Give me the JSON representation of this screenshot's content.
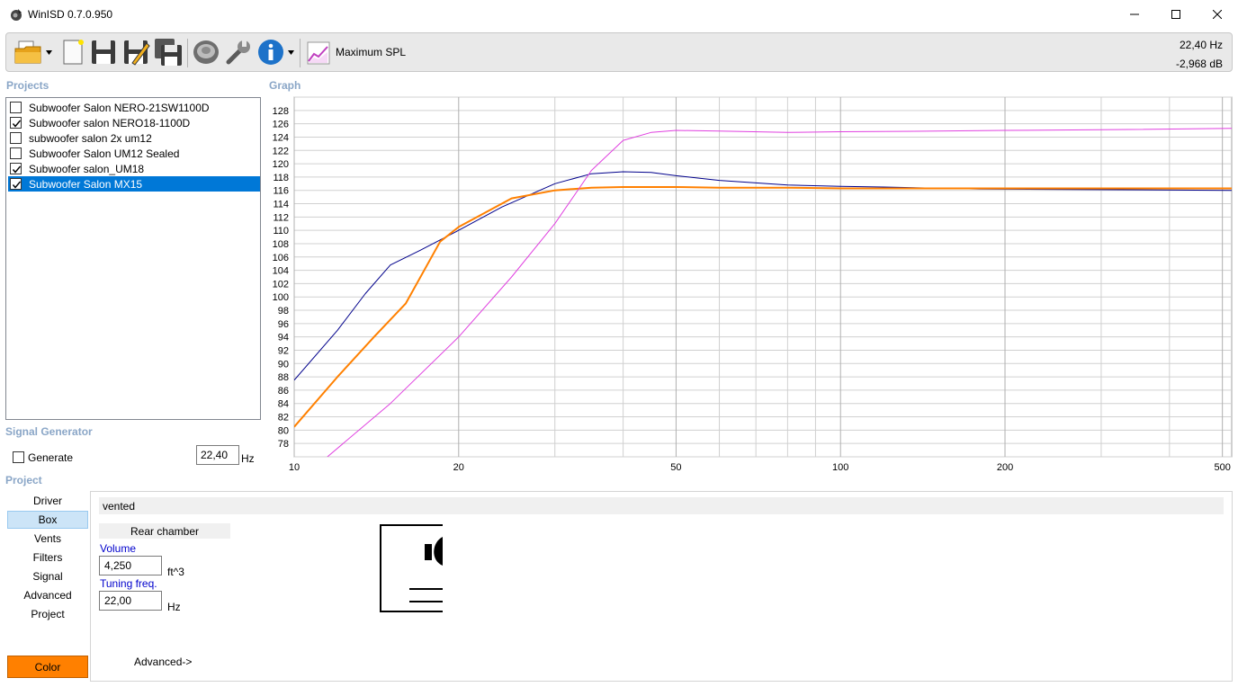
{
  "window": {
    "title": "WinISD 0.7.0.950"
  },
  "toolbar": {
    "mode_label": "Maximum SPL",
    "readout_freq": "22,40 Hz",
    "readout_db": "-2,968 dB"
  },
  "sections": {
    "projects": "Projects",
    "graph": "Graph",
    "signal_generator": "Signal Generator",
    "project": "Project"
  },
  "projects": [
    {
      "label": "Subwoofer Salon NERO-21SW1100D",
      "checked": false,
      "selected": false
    },
    {
      "label": "Subwoofer salon NERO18-1100D",
      "checked": true,
      "selected": false
    },
    {
      "label": "subwoofer salon 2x um12",
      "checked": false,
      "selected": false
    },
    {
      "label": "Subwoofer Salon UM12 Sealed",
      "checked": false,
      "selected": false
    },
    {
      "label": "Subwoofer salon_UM18",
      "checked": true,
      "selected": false
    },
    {
      "label": "Subwoofer Salon MX15",
      "checked": true,
      "selected": true
    }
  ],
  "signal_generator": {
    "generate_label": "Generate",
    "generate_checked": false,
    "frequency": "22,40",
    "unit": "Hz"
  },
  "nav": {
    "items": [
      "Driver",
      "Box",
      "Vents",
      "Filters",
      "Signal",
      "Advanced",
      "Project"
    ],
    "active": "Box",
    "color_button": "Color"
  },
  "box_panel": {
    "type": "vented",
    "rear_chamber": "Rear chamber",
    "volume_label": "Volume",
    "volume_value": "4,250",
    "volume_unit": "ft^3",
    "tuning_label": "Tuning freq.",
    "tuning_value": "22,00",
    "tuning_unit": "Hz",
    "advanced_link": "Advanced->"
  },
  "colors": {
    "accent_selection": "#0078d7",
    "color_button": "#ff8000",
    "section_label": "#8aa6c7",
    "series_blue": "#00008b",
    "series_orange": "#ff8000",
    "series_magenta": "#e040e0"
  },
  "chart_data": {
    "type": "line",
    "title": "",
    "xlabel": "",
    "ylabel": "",
    "x_scale": "log",
    "xlim": [
      10,
      520
    ],
    "ylim": [
      76,
      130
    ],
    "x_ticks": [
      10,
      20,
      50,
      100,
      200,
      500
    ],
    "y_ticks": [
      78,
      80,
      82,
      84,
      86,
      88,
      90,
      92,
      94,
      96,
      98,
      100,
      102,
      104,
      106,
      108,
      110,
      112,
      114,
      116,
      118,
      120,
      122,
      124,
      126,
      128
    ],
    "grid": true,
    "series": [
      {
        "color": "#00008b",
        "width": 1,
        "x": [
          10,
          12,
          13.5,
          15,
          17,
          20,
          24,
          30,
          35,
          40,
          45,
          50,
          60,
          80,
          100,
          120,
          180,
          520
        ],
        "y": [
          87.5,
          95,
          100.5,
          104.8,
          107,
          110,
          113.5,
          117,
          118.5,
          118.8,
          118.7,
          118.2,
          117.5,
          116.8,
          116.6,
          116.5,
          116.2,
          116
        ]
      },
      {
        "color": "#ff8000",
        "width": 2,
        "x": [
          10,
          12,
          14,
          16,
          18.5,
          20,
          25,
          30,
          35,
          40,
          50,
          60,
          80,
          100,
          150,
          200,
          300,
          520
        ],
        "y": [
          80.5,
          88,
          94,
          99,
          108.3,
          110.5,
          114.8,
          116,
          116.4,
          116.5,
          116.5,
          116.4,
          116.4,
          116.3,
          116.3,
          116.3,
          116.3,
          116.3
        ]
      },
      {
        "color": "#e040e0",
        "width": 1,
        "x": [
          11.5,
          15,
          20,
          25,
          30,
          35,
          40,
          45,
          50,
          60,
          80,
          100,
          150,
          200,
          300,
          520
        ],
        "y": [
          76,
          84,
          94,
          103,
          111,
          119,
          123.5,
          124.7,
          125,
          124.9,
          124.7,
          124.8,
          124.9,
          125,
          125.1,
          125.3
        ]
      }
    ]
  }
}
